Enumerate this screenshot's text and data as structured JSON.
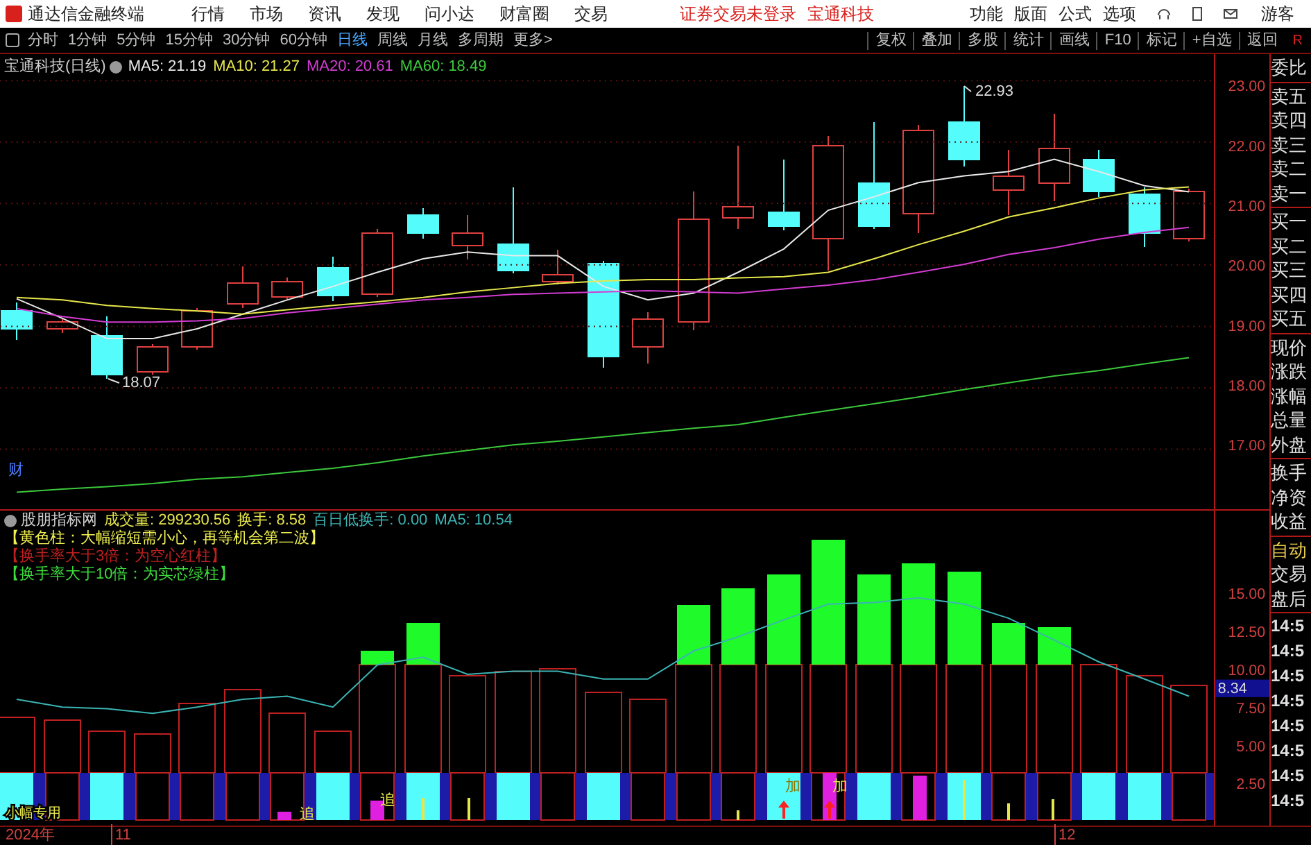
{
  "title_bar": {
    "app_name": "通达信金融终端",
    "menu": [
      "行情",
      "市场",
      "资讯",
      "发现",
      "问小达",
      "财富圈",
      "交易"
    ],
    "notices": [
      "证券交易未登录",
      "宝通科技"
    ],
    "right_menu": [
      "功能",
      "版面",
      "公式",
      "选项"
    ],
    "user": "游客"
  },
  "toolbar": {
    "periods": [
      {
        "label": "分时",
        "selected": false
      },
      {
        "label": "1分钟",
        "selected": false
      },
      {
        "label": "5分钟",
        "selected": false
      },
      {
        "label": "15分钟",
        "selected": false
      },
      {
        "label": "30分钟",
        "selected": false
      },
      {
        "label": "60分钟",
        "selected": false
      },
      {
        "label": "日线",
        "selected": true
      },
      {
        "label": "周线",
        "selected": false
      },
      {
        "label": "月线",
        "selected": false
      },
      {
        "label": "多周期",
        "selected": false
      },
      {
        "label": "更多>",
        "selected": false
      }
    ],
    "buttons": [
      "复权",
      "叠加",
      "多股",
      "统计",
      "画线",
      "F10",
      "标记",
      "+自选",
      "返回"
    ],
    "corner": "R"
  },
  "price_chart": {
    "title": "宝通科技(日线)",
    "ma_labels": [
      {
        "text": "MA5: 21.19",
        "color": "#e8e8e8"
      },
      {
        "text": "MA10: 21.27",
        "color": "#e6e64c"
      },
      {
        "text": "MA20: 20.61",
        "color": "#d23cd2"
      },
      {
        "text": "MA60: 18.49",
        "color": "#3cc83c"
      }
    ],
    "high_label": "22.93",
    "low_label": "18.07",
    "marker": "财",
    "chart_data": {
      "type": "line",
      "ylim": [
        16.0,
        23.5
      ],
      "grid": true,
      "yticks": [
        {
          "value": 23,
          "label": "23.00"
        },
        {
          "value": 22,
          "label": "22.00"
        },
        {
          "value": 21,
          "label": "21.00"
        },
        {
          "value": 20,
          "label": "20.00"
        },
        {
          "value": 19,
          "label": "19.00"
        },
        {
          "value": 18,
          "label": "18.00"
        },
        {
          "value": 17,
          "label": "17.00"
        }
      ],
      "series": [
        {
          "color": "#e8e8e8",
          "values": [
            19.45,
            19.13,
            18.8,
            18.8,
            18.96,
            19.2,
            19.43,
            19.65,
            19.88,
            20.1,
            20.21,
            20.15,
            20.15,
            19.65,
            19.43,
            19.54,
            19.88,
            20.26,
            20.89,
            21.11,
            21.34,
            21.45,
            21.52,
            21.72,
            21.52,
            21.29,
            21.19
          ]
        },
        {
          "color": "#e6e64c",
          "values": [
            19.47,
            19.43,
            19.34,
            19.29,
            19.25,
            19.2,
            19.27,
            19.34,
            19.4,
            19.47,
            19.56,
            19.63,
            19.7,
            19.74,
            19.76,
            19.76,
            19.79,
            19.81,
            19.88,
            20.1,
            20.33,
            20.55,
            20.78,
            20.93,
            21.09,
            21.22,
            21.27
          ]
        },
        {
          "color": "#d23cd2",
          "values": [
            19.29,
            19.16,
            19.07,
            19.07,
            19.09,
            19.13,
            19.22,
            19.29,
            19.36,
            19.43,
            19.47,
            19.52,
            19.54,
            19.56,
            19.58,
            19.56,
            19.54,
            19.61,
            19.67,
            19.76,
            19.88,
            20.01,
            20.17,
            20.28,
            20.42,
            20.53,
            20.61
          ]
        },
        {
          "color": "#3cc83c",
          "values": [
            16.3,
            16.35,
            16.39,
            16.44,
            16.51,
            16.55,
            16.62,
            16.69,
            16.78,
            16.89,
            16.98,
            17.07,
            17.13,
            17.2,
            17.27,
            17.34,
            17.4,
            17.52,
            17.63,
            17.74,
            17.85,
            17.97,
            18.08,
            18.19,
            18.28,
            18.39,
            18.49
          ]
        }
      ]
    }
  },
  "volume_chart": {
    "title": "股朋指标网",
    "readings": [
      {
        "text": "成交量: 299230.56",
        "color": "#e6e64c"
      },
      {
        "text": "换手: 8.58",
        "color": "#e6e64c"
      },
      {
        "text": "百日低换手: 0.00",
        "color": "#3cb4b4"
      },
      {
        "text": "MA5: 10.54",
        "color": "#3cb4b4"
      }
    ],
    "notes": [
      {
        "text": "【黄色柱：大幅缩短需小心，再等机会第二波】",
        "color": "#f0f050"
      },
      {
        "text": "【换手率大于3倍：为空心红柱】",
        "color": "#c02020"
      },
      {
        "text": "【换手率大于10倍：为实芯绿柱】",
        "color": "#3cdc3c"
      }
    ],
    "current_value": "8.34",
    "signals": [
      "追",
      "追",
      "加",
      "加"
    ],
    "strip_label": "小幅专用",
    "chart_data": {
      "type": "line",
      "ylim": [
        0,
        20.2
      ],
      "yticks": [
        {
          "value": 15,
          "label": "15.00"
        },
        {
          "value": 12.5,
          "label": "12.50"
        },
        {
          "value": 10,
          "label": "10.00"
        },
        {
          "value": 7.5,
          "label": "7.50"
        },
        {
          "value": 5,
          "label": "5.00"
        },
        {
          "value": 2.5,
          "label": "2.50"
        }
      ],
      "series": [
        {
          "color": "#3cb4b4",
          "values": [
            8.1,
            7.6,
            7.5,
            7.2,
            7.6,
            8.1,
            8.3,
            7.6,
            10.3,
            10.8,
            9.7,
            9.9,
            9.9,
            9.4,
            9.4,
            11.2,
            12.1,
            13.2,
            14.2,
            14.3,
            14.6,
            14.2,
            13.3,
            11.9,
            10.5,
            9.4,
            8.3
          ]
        }
      ]
    }
  },
  "date_axis": [
    "2024年",
    "11",
    "12"
  ],
  "side_panel": {
    "groups": [
      [
        "委比"
      ],
      [
        "卖五",
        "卖四",
        "卖三",
        "卖二",
        "卖一"
      ],
      [
        "买一",
        "买二",
        "买三",
        "买四",
        "买五"
      ],
      [
        "现价",
        "涨跌",
        "涨幅",
        "总量",
        "外盘"
      ],
      [
        "换手",
        "净资",
        "收益"
      ]
    ],
    "auto": "自动",
    "trade_labels": [
      "交易",
      "盘后"
    ],
    "times": [
      "14:5",
      "14:5",
      "14:5",
      "14:5",
      "14:5",
      "14:5",
      "14:5",
      "14:5"
    ]
  }
}
